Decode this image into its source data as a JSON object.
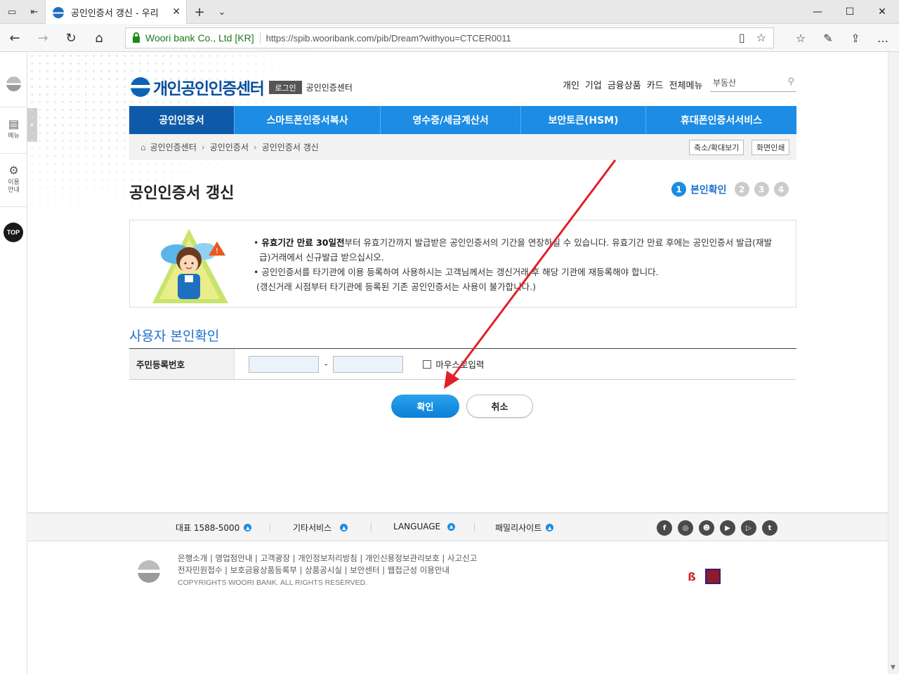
{
  "browser": {
    "tab_title": "공인인증서 갱신 - 우리",
    "site_identity": "Woori bank Co., Ltd [KR]",
    "url": "https://spib.wooribank.com/pib/Dream?withyou=CTCER0011"
  },
  "quick_menu": {
    "menu_label": "메뉴",
    "guide_label_1": "이용",
    "guide_label_2": "안내",
    "top_label": "TOP"
  },
  "header": {
    "logo_text": "개인공인인증센터",
    "login_label": "로그인",
    "sub_center": "공인인증센터",
    "top_links": [
      "개인",
      "기업",
      "금융상품",
      "카드",
      "전체메뉴"
    ],
    "search_value": "부동산"
  },
  "gnb": [
    "공인인증서",
    "스마트폰인증서복사",
    "영수증/세금계산서",
    "보안토큰(HSM)",
    "휴대폰인증서서비스"
  ],
  "breadcrumb": {
    "items": [
      "공인인증센터",
      "공인인증서",
      "공인인증서 갱신"
    ],
    "zoom_button": "축소/확대보기",
    "print_button": "화면인쇄"
  },
  "page_title": "공인인증서 갱신",
  "steps": {
    "current_number": "1",
    "current_label": "본인확인",
    "others": [
      "2",
      "3",
      "4"
    ]
  },
  "info": {
    "line1_bold": "유효기간 만료 30일전",
    "line1_rest": "부터 유효기간까지 발급받은 공인인증서의 기간을 연장하실 수 있습니다. 유효기간 만료 후에는 공인인증서 발급(재발급)거래에서 신규발급 받으십시오.",
    "line2": "공인인증서를 타기관에 이용 등록하여 사용하시는 고객님께서는 갱신거래 후 해당 기관에 재등록해야 합니다.",
    "line3": "(갱신거래 시점부터 타기관에 등록된 기존 공인인증서는 사용이 불가합니다.)"
  },
  "section_title": "사용자 본인확인",
  "form": {
    "ssn_label": "주민등록번호",
    "dash": "-",
    "mouse_input_label": "마우스로입력"
  },
  "buttons": {
    "confirm": "확인",
    "cancel": "취소"
  },
  "footer": {
    "phone": "대표 1588-5000",
    "other_services": "기타서비스",
    "language": "LANGUAGE",
    "family_sites": "패밀리사이트",
    "links_line1": "은행소개 | 영업점안내 | 고객광장 | 개인정보처리방침 | 개인신용정보관리보호 | 사고신고",
    "links_line2": "전자민원접수 | 보호금융상품등록부 | 상품공시실 | 보안센터 | 웹접근성 이용안내",
    "copyright": "COPYRIGHTS WOORI BANK. ALL RIGHTS RESERVED."
  },
  "colors": {
    "brand_blue": "#1c8ce4",
    "nav_active": "#0f5aa8",
    "annotation_arrow": "#e0202a"
  },
  "icons": [
    "tab-list-icon",
    "tab-aside-icon",
    "back-icon",
    "forward-icon",
    "refresh-icon",
    "home-icon",
    "lock-icon",
    "reading-view-icon",
    "favorite-star-icon",
    "favorites-icon",
    "pen-icon",
    "share-icon",
    "more-icon",
    "search-icon",
    "facebook-icon",
    "instagram-icon",
    "youtube-icon",
    "blog-icon",
    "twitter-icon"
  ]
}
